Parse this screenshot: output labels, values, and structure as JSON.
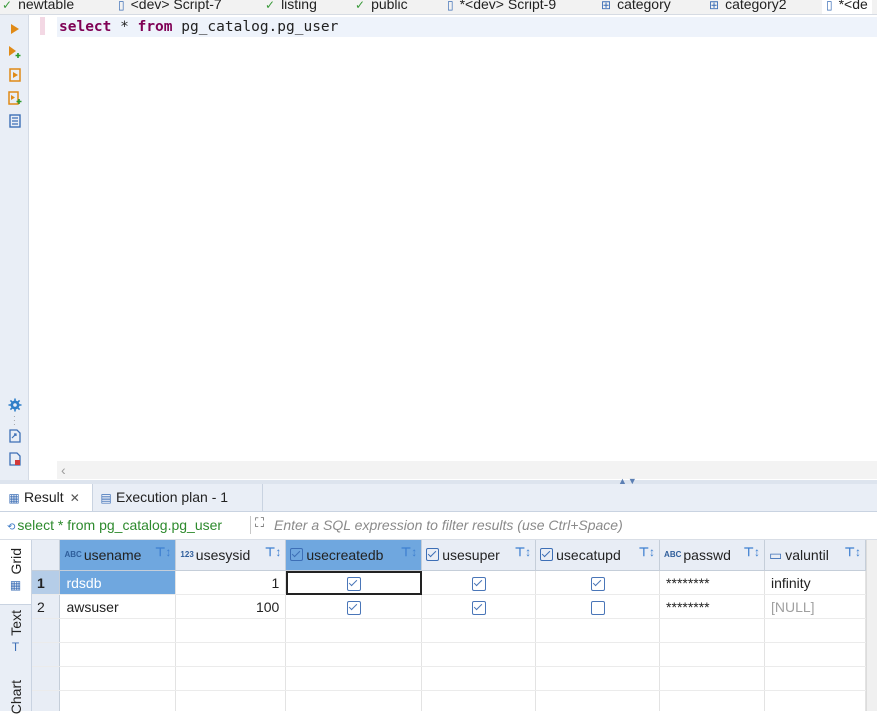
{
  "editor_tabs": [
    {
      "label": "newtable",
      "icon": "table-icon"
    },
    {
      "label": "<dev> Script-7",
      "icon": "script-icon"
    },
    {
      "label": "listing",
      "icon": "table-icon"
    },
    {
      "label": "public",
      "icon": "schema-icon"
    },
    {
      "label": "*<dev> Script-9",
      "icon": "script-icon"
    },
    {
      "label": "category",
      "icon": "table-icon"
    },
    {
      "label": "category2",
      "icon": "table-icon"
    },
    {
      "label": "*<de",
      "icon": "script-icon"
    }
  ],
  "editor": {
    "sql_keyword1": "select",
    "sql_star": " * ",
    "sql_keyword2": "from",
    "sql_rest": " pg_catalog.pg_user"
  },
  "result_tabs": {
    "result_label": "Result",
    "plan_label": "Execution plan - 1"
  },
  "filter": {
    "query": "select * from pg_catalog.pg_user",
    "placeholder": "Enter a SQL expression to filter results (use Ctrl+Space)"
  },
  "view_tabs": {
    "grid": "Grid",
    "text": "Text",
    "chart": "Chart"
  },
  "grid": {
    "columns": [
      {
        "name": "usename",
        "type_tag": "ABC"
      },
      {
        "name": "usesysid",
        "type_tag": "123"
      },
      {
        "name": "usecreatedb",
        "type_tag": "bool"
      },
      {
        "name": "usesuper",
        "type_tag": "bool"
      },
      {
        "name": "usecatupd",
        "type_tag": "bool"
      },
      {
        "name": "passwd",
        "type_tag": "ABC"
      },
      {
        "name": "valuntil",
        "type_tag": "date"
      }
    ],
    "rows": [
      {
        "num": "1",
        "usename": "rdsdb",
        "usesysid": "1",
        "usecreatedb": true,
        "usesuper": true,
        "usecatupd": true,
        "passwd": "********",
        "valuntil": "infinity"
      },
      {
        "num": "2",
        "usename": "awsuser",
        "usesysid": "100",
        "usecreatedb": true,
        "usesuper": true,
        "usecatupd": false,
        "passwd": "********",
        "valuntil": "[NULL]"
      }
    ]
  },
  "colors": {
    "keyword": "#7f0055",
    "selection": "#6fa7df",
    "filter_query": "#2d8a2d"
  }
}
